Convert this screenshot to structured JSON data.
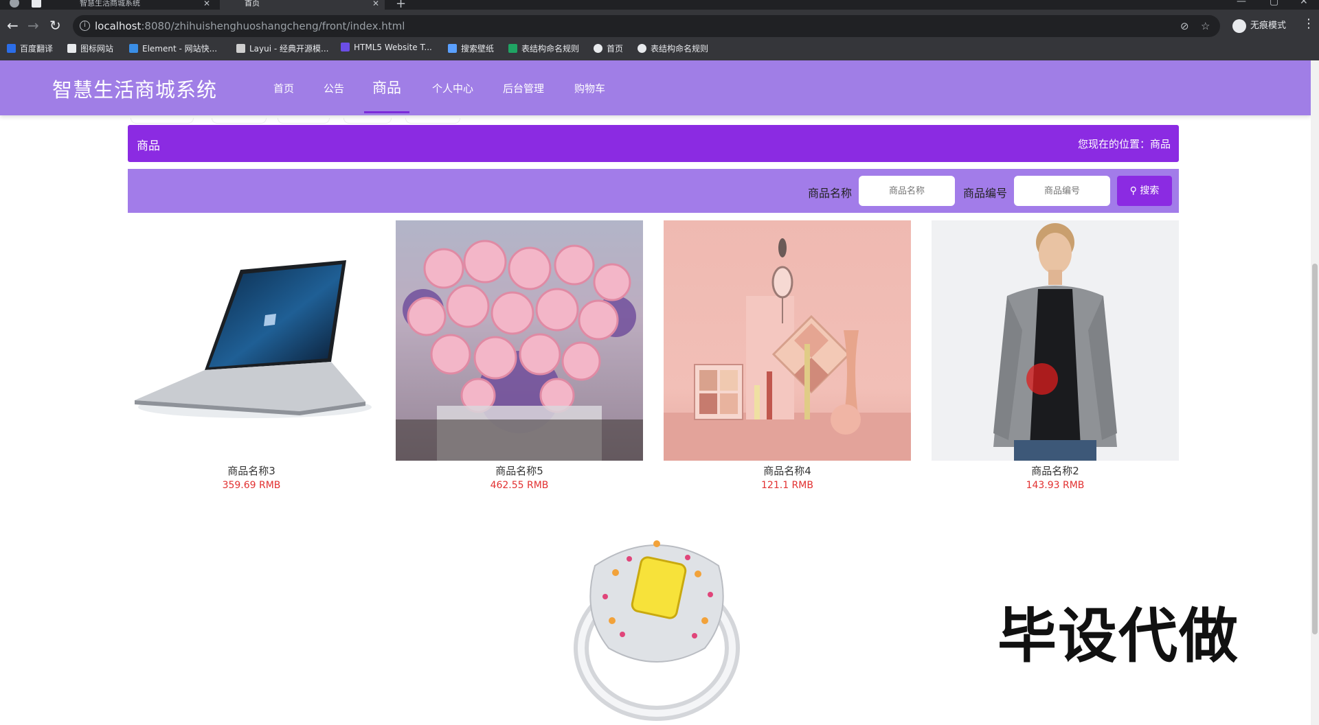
{
  "browser": {
    "tabs": [
      {
        "title": "智慧生活商城系统",
        "active": false
      },
      {
        "title": "首页",
        "active": true
      }
    ],
    "url_host": "localhost",
    "url_rest": ":8080/zhihuishenghuoshangcheng/front/index.html",
    "profile_label": "无痕模式",
    "bookmarks": [
      {
        "label": "百度翻译",
        "color": "#2b6de8"
      },
      {
        "label": "图标网站",
        "color": "#ffffff"
      },
      {
        "label": "Element - 网站快...",
        "color": "#3a8ee6"
      },
      {
        "label": "Layui - 经典开源模...",
        "color": "#ffffff"
      },
      {
        "label": "HTML5 Website T...",
        "color": "#6b4ee6"
      },
      {
        "label": "搜索壁纸",
        "color": "#5aa0ff"
      },
      {
        "label": "表结构命名规则",
        "color": "#1fa463"
      },
      {
        "label": "首页",
        "color": "#ffffff"
      },
      {
        "label": "表结构命名规则",
        "color": "#ffffff"
      }
    ]
  },
  "site": {
    "brand": "智慧生活商城系统",
    "nav": [
      "首页",
      "公告",
      "商品",
      "个人中心",
      "后台管理",
      "购物车"
    ],
    "active_nav": "商品",
    "accent_color": "#8b2be2",
    "header_color": "#a07ee6"
  },
  "breadcrumb": {
    "title": "商品",
    "position": "您现在的位置：商品"
  },
  "search": {
    "name_label": "商品名称",
    "name_placeholder": "商品名称",
    "code_label": "商品编号",
    "code_placeholder": "商品编号",
    "button_label": "搜索"
  },
  "products": [
    {
      "name": "商品名称3",
      "price": "359.69 RMB",
      "image": "laptop"
    },
    {
      "name": "商品名称5",
      "price": "462.55 RMB",
      "image": "flower-bouquet"
    },
    {
      "name": "商品名称4",
      "price": "121.1 RMB",
      "image": "cosmetics-palette"
    },
    {
      "name": "商品名称2",
      "price": "143.93 RMB",
      "image": "man-in-jacket"
    },
    {
      "name": "",
      "price": "",
      "image": "diamond-ring"
    }
  ],
  "watermark": "毕设代做"
}
